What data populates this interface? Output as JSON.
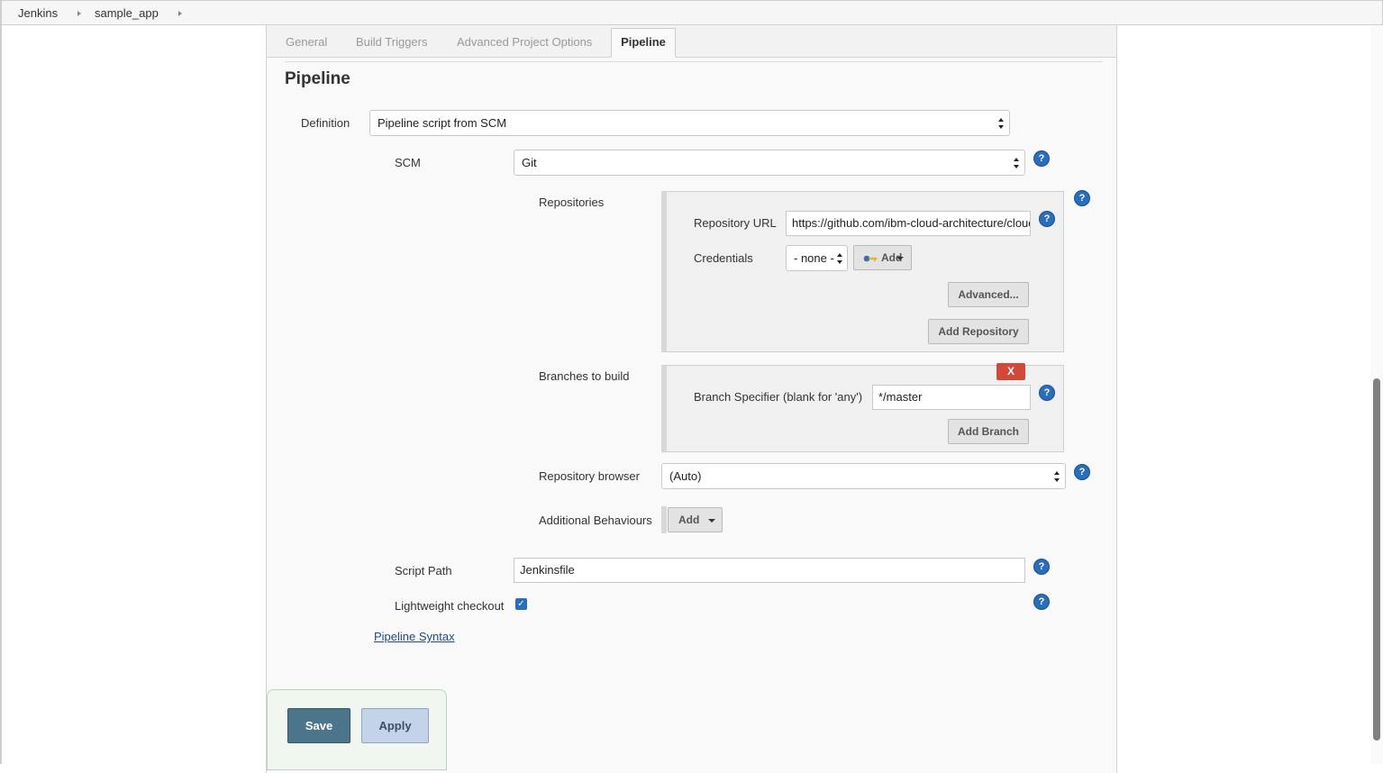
{
  "breadcrumb": {
    "items": [
      "Jenkins",
      "sample_app"
    ]
  },
  "tabs": [
    {
      "label": "General",
      "active": false
    },
    {
      "label": "Build Triggers",
      "active": false
    },
    {
      "label": "Advanced Project Options",
      "active": false
    },
    {
      "label": "Pipeline",
      "active": true
    }
  ],
  "section": {
    "title": "Pipeline"
  },
  "definition": {
    "label": "Definition",
    "value": "Pipeline script from SCM"
  },
  "scm": {
    "label": "SCM",
    "value": "Git"
  },
  "repositories": {
    "label": "Repositories",
    "url_label": "Repository URL",
    "url_value": "https://github.com/ibm-cloud-architecture/cloud",
    "credentials_label": "Credentials",
    "credentials_value": "- none -",
    "add_credentials_label": "Add",
    "advanced_label": "Advanced...",
    "add_repository_label": "Add Repository"
  },
  "branches": {
    "label": "Branches to build",
    "delete_label": "X",
    "specifier_label": "Branch Specifier (blank for 'any')",
    "specifier_value": "*/master",
    "add_branch_label": "Add Branch"
  },
  "repository_browser": {
    "label": "Repository browser",
    "value": "(Auto)"
  },
  "additional_behaviours": {
    "label": "Additional Behaviours",
    "add_label": "Add"
  },
  "script_path": {
    "label": "Script Path",
    "value": "Jenkinsfile"
  },
  "lightweight_checkout": {
    "label": "Lightweight checkout",
    "checked": true
  },
  "pipeline_syntax_link": "Pipeline Syntax",
  "help_icon_glyph": "?",
  "actions": {
    "save_label": "Save",
    "apply_label": "Apply"
  },
  "colors": {
    "save": "#4b758b",
    "apply": "#c5d3e8",
    "delete": "#d24939",
    "help": "#2a6ebb"
  }
}
